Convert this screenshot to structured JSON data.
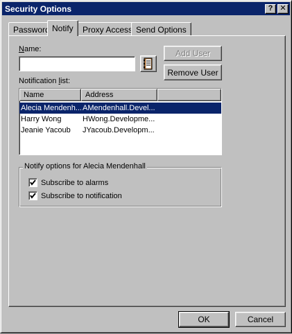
{
  "window": {
    "title": "Security Options",
    "help_label": "?",
    "close_label": "✕"
  },
  "tabs": [
    {
      "label": "Password",
      "active": false
    },
    {
      "label": "Notify",
      "active": true
    },
    {
      "label": "Proxy Access",
      "active": false
    },
    {
      "label": "Send Options",
      "active": false
    }
  ],
  "notify": {
    "name_label_u": "N",
    "name_label_rest": "ame:",
    "name_value": "",
    "add_user_label": "Add User",
    "remove_user_label": "Remove User",
    "list_label_pre": "Notification ",
    "list_label_u": "l",
    "list_label_rest": "ist:",
    "columns": [
      "Name",
      "Address"
    ],
    "rows": [
      {
        "name": "Alecia Mendenh...",
        "address": "AMendenhall.Devel...",
        "selected": true
      },
      {
        "name": "Harry Wong",
        "address": "HWong.Developme...",
        "selected": false
      },
      {
        "name": "Jeanie Yacoub",
        "address": "JYacoub.Developm...",
        "selected": false
      }
    ],
    "options_group_title": "Notify options for Alecia Mendenhall",
    "options": [
      {
        "label": "Subscribe to alarms",
        "checked": true
      },
      {
        "label": "Subscribe to notification",
        "checked": true
      }
    ]
  },
  "footer": {
    "ok_label": "OK",
    "cancel_label": "Cancel"
  },
  "colors": {
    "face": "#c0c0c0",
    "titlebar": "#0a246a",
    "selection": "#0a246a"
  },
  "icons": {
    "address_book": "address-book-icon",
    "checkmark": "checkmark-icon"
  }
}
